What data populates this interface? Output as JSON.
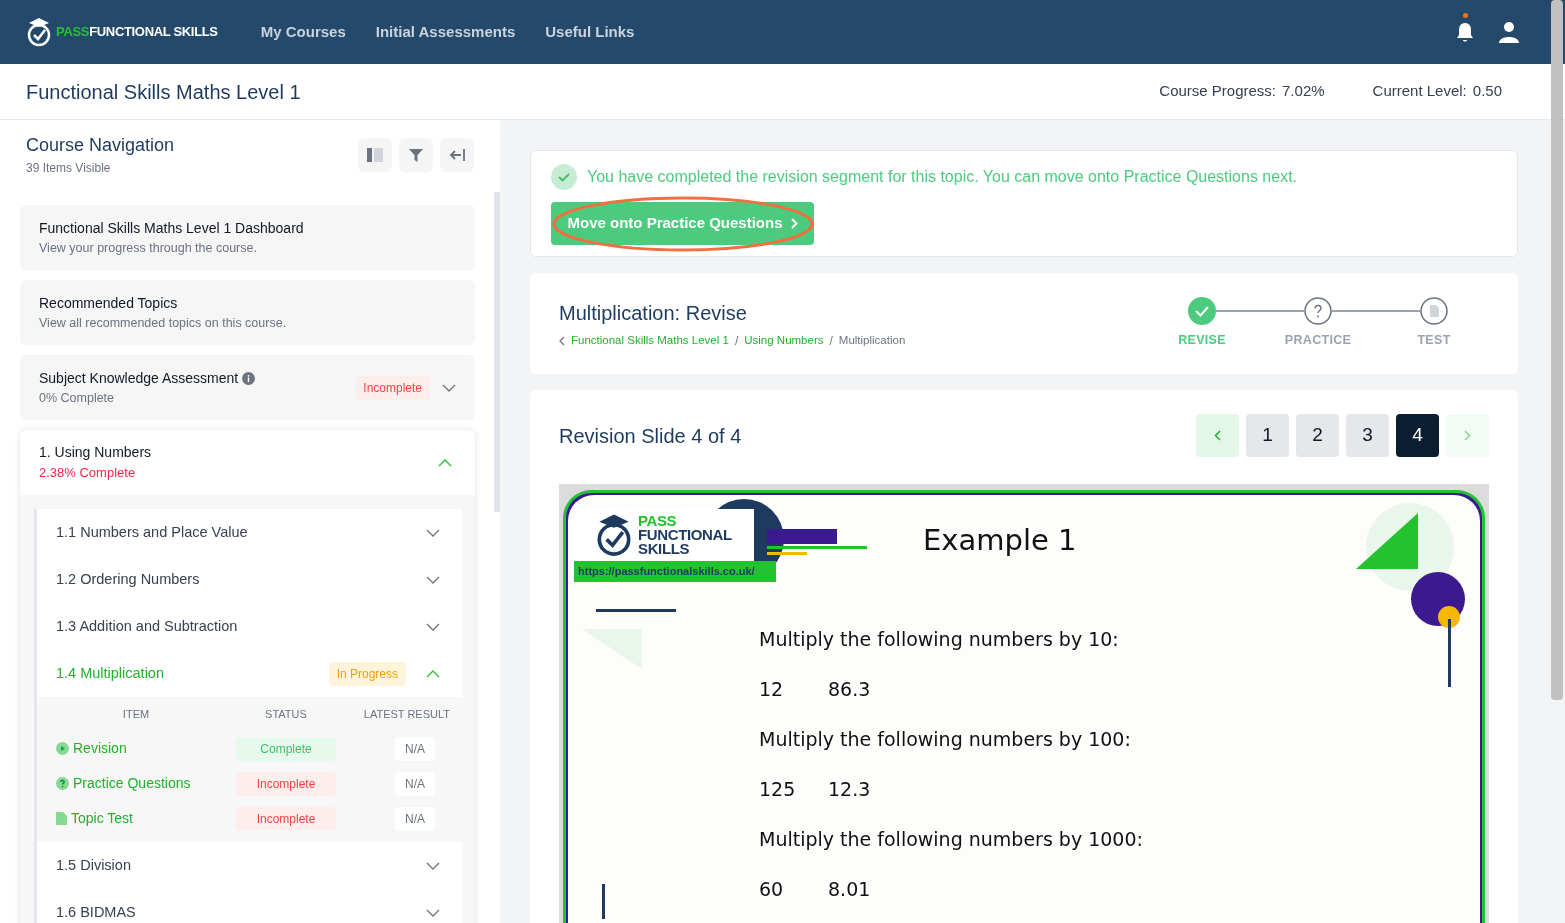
{
  "nav": {
    "logo": {
      "accent": "PASS",
      "rest": "FUNCTIONAL SKILLS"
    },
    "links": [
      "My Courses",
      "Initial Assessments",
      "Useful Links"
    ],
    "notification": true
  },
  "course": {
    "title": "Functional Skills Maths Level 1",
    "progress_label": "Course Progress:",
    "progress_value": "7.02%",
    "level_label": "Current Level:",
    "level_value": "0.50"
  },
  "sidebar": {
    "title": "Course Navigation",
    "subtitle": "39 Items Visible",
    "cards": [
      {
        "kind": "link",
        "title": "Functional Skills Maths Level 1 Dashboard",
        "subtitle": "View your progress through the course."
      },
      {
        "kind": "link",
        "title": "Recommended Topics",
        "subtitle": "View all recommended topics on this course."
      },
      {
        "kind": "assessment",
        "title": "Subject Knowledge Assessment",
        "subtitle": "0% Complete",
        "badge": "Incomplete",
        "expanded": false
      }
    ],
    "unit": {
      "title": "1. Using Numbers",
      "progress": "2.38% Complete",
      "complete": false,
      "expanded": true,
      "topics": [
        {
          "title": "1.1 Numbers and Place Value",
          "selected": false,
          "expanded": false
        },
        {
          "title": "1.2 Ordering Numbers",
          "selected": false,
          "expanded": false
        },
        {
          "title": "1.3 Addition and Subtraction",
          "selected": false,
          "expanded": false
        },
        {
          "title": "1.4 Multiplication",
          "selected": true,
          "expanded": true,
          "badge": "In Progress",
          "columns": [
            "ITEM",
            "STATUS",
            "LATEST RESULT"
          ],
          "items": [
            {
              "kind": "revision",
              "name": "Revision",
              "status": "Complete",
              "complete": true,
              "result": "N/A"
            },
            {
              "kind": "practice",
              "name": "Practice Questions",
              "status": "Incomplete",
              "complete": false,
              "result": "N/A"
            },
            {
              "kind": "test",
              "name": "Topic Test",
              "status": "Incomplete",
              "complete": false,
              "result": "N/A"
            }
          ]
        },
        {
          "title": "1.5 Division",
          "selected": false,
          "expanded": false
        },
        {
          "title": "1.6 BIDMAS",
          "selected": false,
          "expanded": false
        }
      ]
    }
  },
  "notice": {
    "message": "You have completed the revision segment for this topic. You can move onto Practice Questions next.",
    "button": "Move onto Practice Questions",
    "highlighted": true
  },
  "lesson": {
    "title": "Multiplication: Revise",
    "breadcrumb_separator": "/",
    "breadcrumb": [
      {
        "label": "Functional Skills Maths Level 1",
        "link": true
      },
      {
        "label": "Using Numbers",
        "link": true
      },
      {
        "label": "Multiplication",
        "link": false
      }
    ],
    "steps": [
      {
        "label": "REVISE",
        "kind": "revise",
        "done": true
      },
      {
        "label": "PRACTICE",
        "kind": "practice",
        "done": false
      },
      {
        "label": "TEST",
        "kind": "test",
        "done": false
      }
    ]
  },
  "slides": {
    "title": "Revision Slide 4 of 4",
    "prev_disabled": false,
    "next_disabled": true,
    "pages": [
      {
        "label": "1",
        "selected": false
      },
      {
        "label": "2",
        "selected": false
      },
      {
        "label": "3",
        "selected": false
      },
      {
        "label": "4",
        "selected": true
      }
    ],
    "slide": {
      "logo": [
        "PASS",
        "FUNCTIONAL",
        "SKILLS"
      ],
      "url": "https://passfunctionalskills.co.uk/",
      "heading": "Example 1",
      "blocks": [
        {
          "kind": "prompt",
          "text": "Multiply the following numbers by 10:"
        },
        {
          "kind": "numbers",
          "values": [
            "12",
            "86.3"
          ]
        },
        {
          "kind": "prompt",
          "text": "Multiply the following numbers by 100:"
        },
        {
          "kind": "numbers",
          "values": [
            "125",
            "12.3"
          ]
        },
        {
          "kind": "prompt",
          "text": "Multiply the following numbers by 1000:"
        },
        {
          "kind": "numbers",
          "values": [
            "60",
            "8.01"
          ]
        }
      ]
    }
  }
}
